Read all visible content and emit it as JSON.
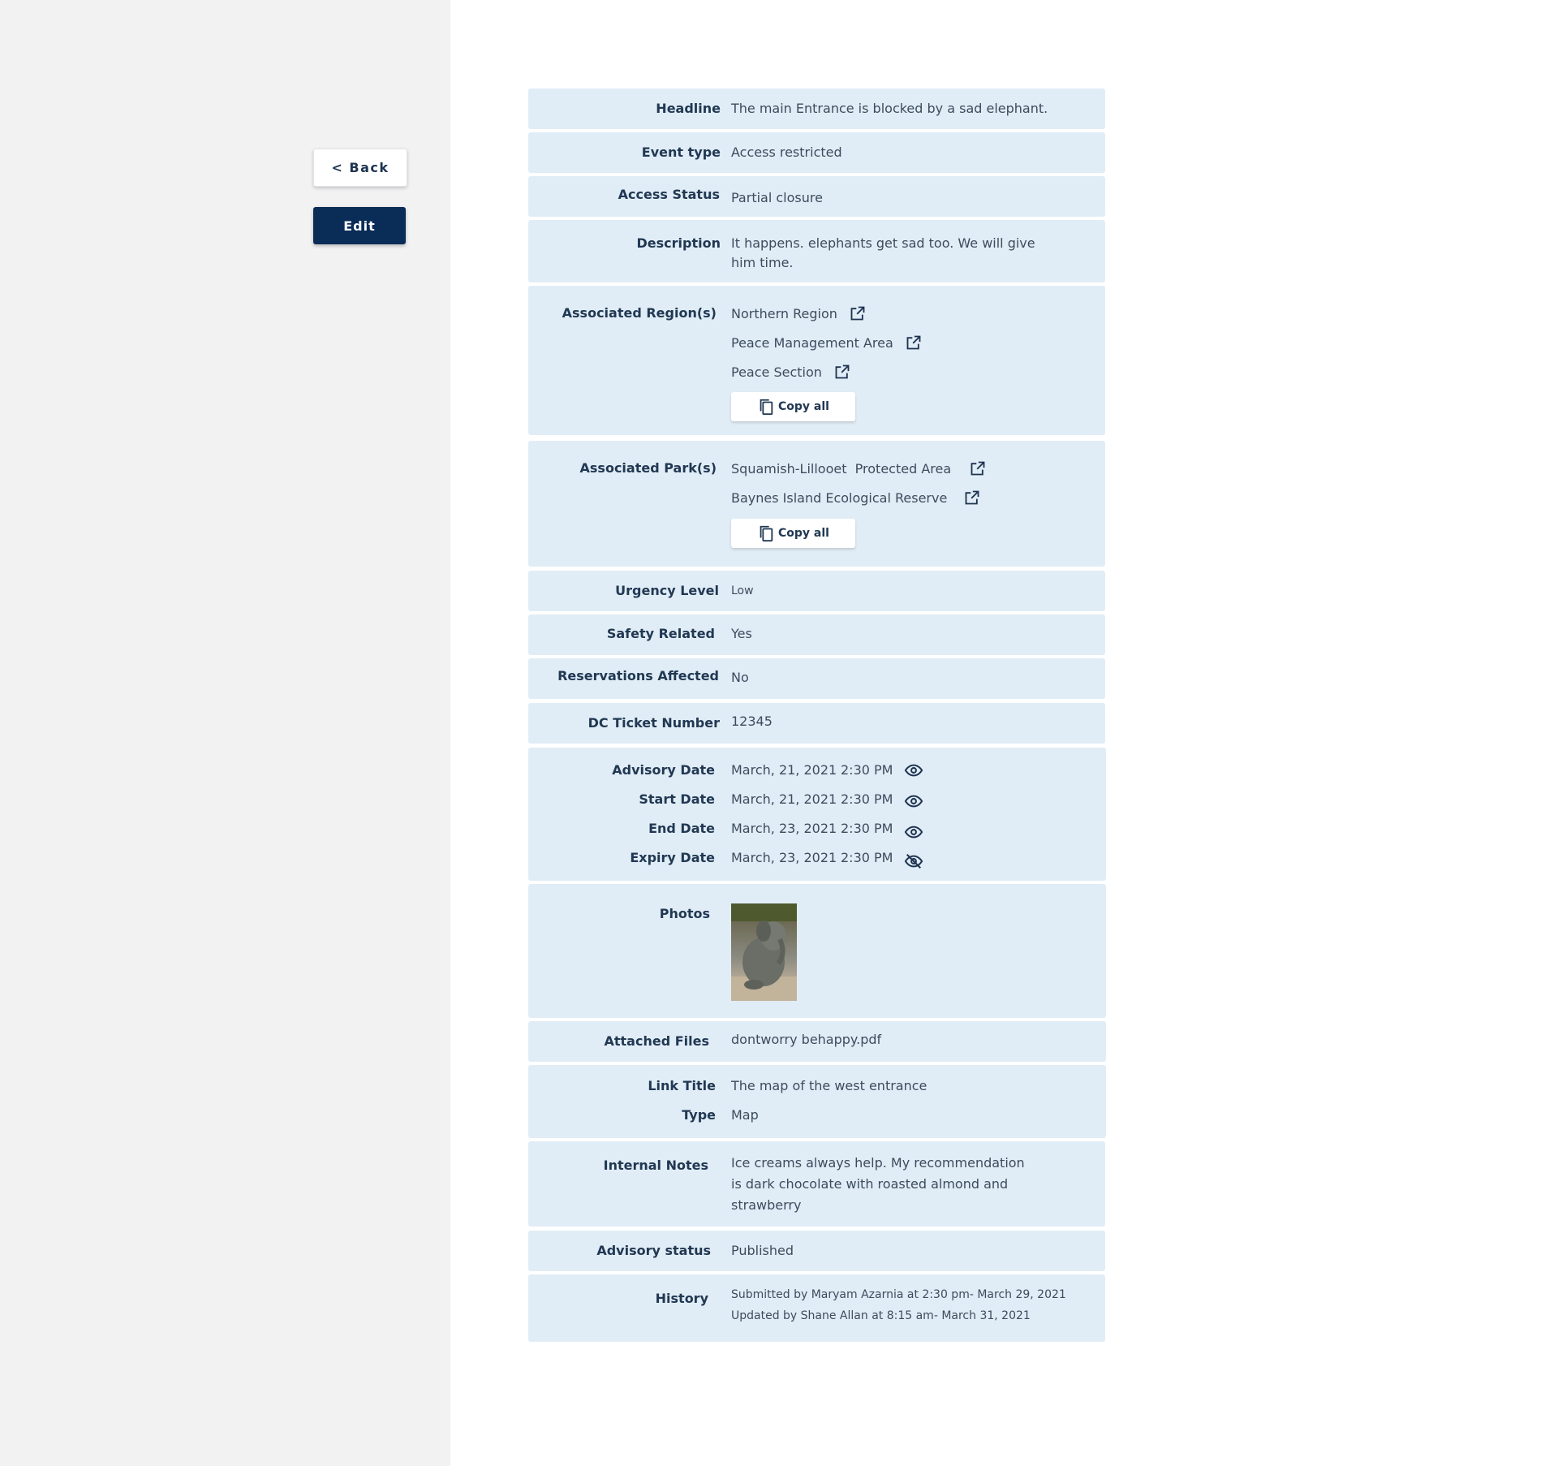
{
  "nav": {
    "back_label": "< Back",
    "edit_label": "Edit"
  },
  "advisory": {
    "headline": {
      "label": "Headline",
      "value": "The main Entrance is blocked by a sad elephant."
    },
    "event_type": {
      "label": "Event type",
      "value": "Access restricted"
    },
    "access_status": {
      "label": "Access Status",
      "value": "Partial closure"
    },
    "description": {
      "label": "Description",
      "value": "It happens. elephants get sad too.  We will give him time."
    },
    "regions": {
      "label": "Associated Region(s)",
      "items": [
        "Northern Region",
        "Peace Management Area",
        "Peace Section"
      ],
      "copy_label": "Copy all"
    },
    "parks": {
      "label": "Associated Park(s)",
      "items": [
        "Squamish-Lillooet  Protected Area",
        "Baynes Island Ecological Reserve"
      ],
      "copy_label": "Copy all"
    },
    "urgency": {
      "label": "Urgency Level",
      "value": "Low"
    },
    "safety": {
      "label": "Safety Related",
      "value": "Yes"
    },
    "reservations": {
      "label": "Reservations Affected",
      "value": "No"
    },
    "dc_ticket": {
      "label": "DC Ticket Number",
      "value": "12345"
    },
    "dates": [
      {
        "label": "Advisory Date",
        "date": "March, 21, 2021",
        "time": "2:30 PM",
        "icon": "eye-icon"
      },
      {
        "label": "Start Date",
        "date": "March, 21, 2021",
        "time": "2:30 PM",
        "icon": "eye-icon"
      },
      {
        "label": "End Date",
        "date": "March, 23, 2021",
        "time": "2:30 PM",
        "icon": "eye-icon"
      },
      {
        "label": "Expiry Date",
        "date": "March, 23, 2021",
        "time": "2:30 PM",
        "icon": "eye-off-icon"
      }
    ],
    "photos": {
      "label": "Photos"
    },
    "files": {
      "label": "Attached Files",
      "value": "dontworry behappy.pdf"
    },
    "link": {
      "title_label": "Link Title",
      "title_value": "The map of the west entrance",
      "type_label": "Type",
      "type_value": "Map"
    },
    "notes": {
      "label": "Internal Notes",
      "value": "Ice creams always help. My recommendation is dark chocolate with roasted almond and strawberry"
    },
    "status": {
      "label": "Advisory status",
      "value": "Published"
    },
    "history": {
      "label": "History",
      "entries": [
        "Submitted by Maryam Azarnia at 2:30 pm- March 29, 2021",
        "Updated by Shane Allan at 8:15 am- March 31, 2021"
      ]
    }
  },
  "colors": {
    "row_bg": "#e1edf6",
    "primary": "#0a2d57",
    "label": "#213853",
    "sidebar_bg": "#f2f2f2"
  }
}
